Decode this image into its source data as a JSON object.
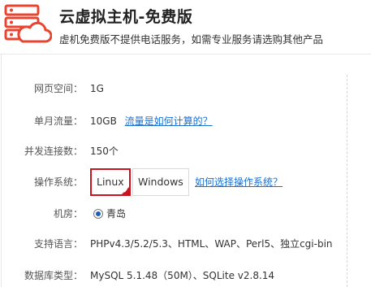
{
  "header": {
    "title": "云虚拟主机-免费版",
    "subtitle": "虚机免费版不提供电话服务，如需专业服务请选购其他产品",
    "logo_icon": "server-cloud-icon",
    "brand_color": "#e8442f"
  },
  "specs": {
    "space": {
      "label": "网页空间：",
      "value": "1G"
    },
    "traffic": {
      "label": "单月流量：",
      "value": "10GB",
      "link": "流量是如何计算的？"
    },
    "connections": {
      "label": "并发连接数：",
      "value": "150个"
    },
    "os": {
      "label": "操作系统：",
      "options": [
        "Linux",
        "Windows"
      ],
      "selected": "Linux",
      "link": "如何选择操作系统？"
    },
    "room": {
      "label": "机房：",
      "value": "青岛"
    },
    "languages": {
      "label": "支持语言：",
      "value": "PHPv4.3/5.2/5.3、HTML、WAP、Perl5、独立cgi-bin"
    },
    "database": {
      "label": "数据库类型：",
      "value": "MySQL 5.1.48（50M）、SQLite v2.8.14"
    }
  },
  "colors": {
    "accent": "#c8141e",
    "link": "#1a6fcf"
  }
}
